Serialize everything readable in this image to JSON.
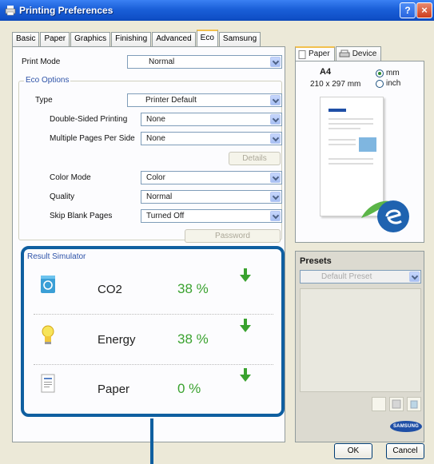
{
  "window": {
    "title": "Printing Preferences",
    "help_label": "?",
    "close_label": "×"
  },
  "tabs": [
    "Basic",
    "Paper",
    "Graphics",
    "Finishing",
    "Advanced",
    "Eco",
    "Samsung"
  ],
  "active_tab": "Eco",
  "eco": {
    "print_mode_label": "Print Mode",
    "print_mode_value": "Normal",
    "options_title": "Eco Options",
    "type_label": "Type",
    "type_value": "Printer Default",
    "double_sided_label": "Double-Sided Printing",
    "double_sided_value": "None",
    "multiple_pages_label": "Multiple Pages Per Side",
    "multiple_pages_value": "None",
    "details_label": "Details",
    "color_mode_label": "Color Mode",
    "color_mode_value": "Color",
    "quality_label": "Quality",
    "quality_value": "Normal",
    "skip_blank_label": "Skip Blank Pages",
    "skip_blank_value": "Turned Off",
    "password_label": "Password"
  },
  "simulator": {
    "title": "Result Simulator",
    "rows": [
      {
        "label": "CO2",
        "value": "38 %",
        "icon": "recycle-bin-icon"
      },
      {
        "label": "Energy",
        "value": "38 %",
        "icon": "light-bulb-icon"
      },
      {
        "label": "Paper",
        "value": "0 %",
        "icon": "paper-document-icon"
      }
    ],
    "accent_color": "#0f5fa0",
    "value_color": "#3aa22f"
  },
  "preview": {
    "tabs": [
      "Paper",
      "Device"
    ],
    "paper_size": "A4",
    "paper_dimensions": "210 x 297 mm",
    "unit_mm": "mm",
    "unit_inch": "inch",
    "selected_unit": "mm"
  },
  "presets": {
    "title": "Presets",
    "selected": "Default Preset"
  },
  "brand": "SAMSUNG",
  "buttons": {
    "ok": "OK",
    "cancel": "Cancel"
  }
}
